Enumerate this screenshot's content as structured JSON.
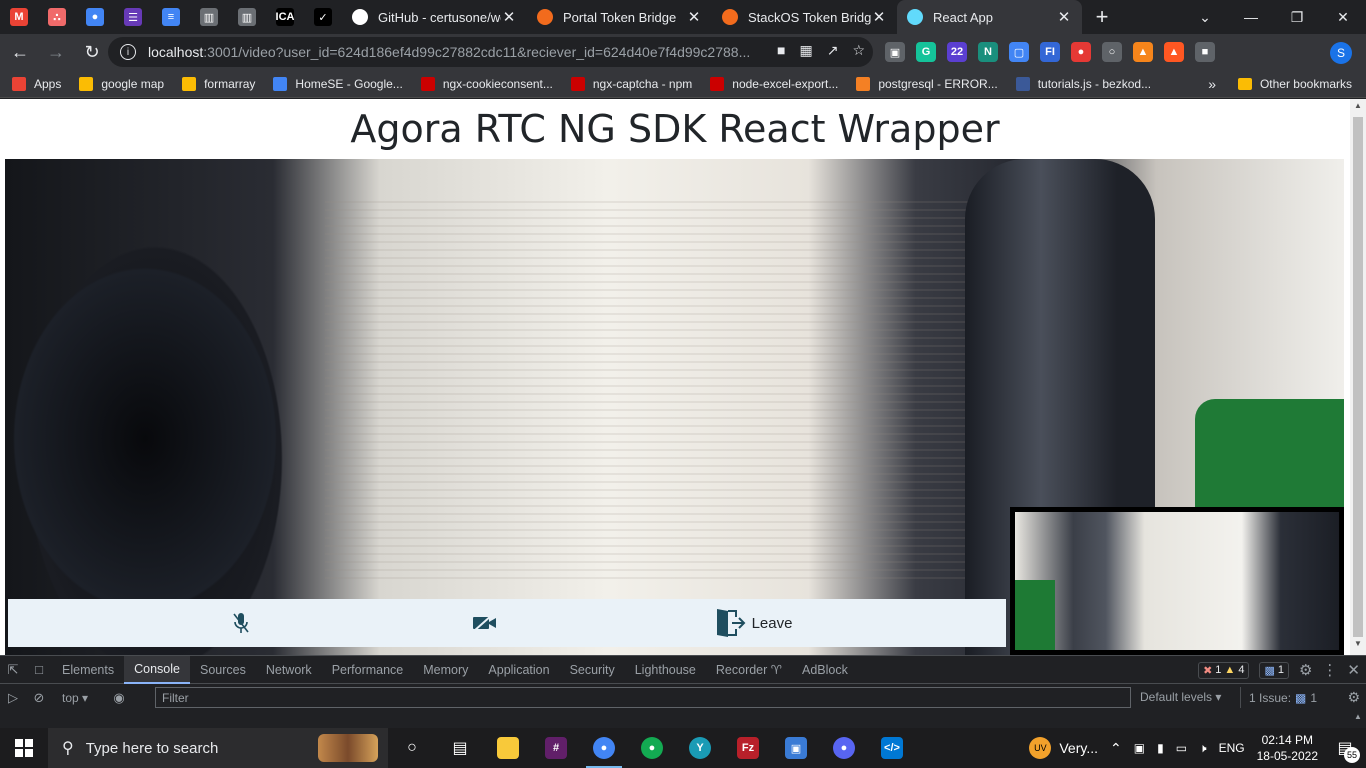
{
  "browser": {
    "pinned_tabs": [
      {
        "name": "gmail",
        "glyph": "M",
        "color": "#ea4335"
      },
      {
        "name": "asana",
        "glyph": "∴",
        "color": "#f06a6a"
      },
      {
        "name": "chrome-store",
        "glyph": "●",
        "color": "#4285f4"
      },
      {
        "name": "forms",
        "glyph": "☰",
        "color": "#673ab7"
      },
      {
        "name": "docs",
        "glyph": "≡",
        "color": "#4285f4"
      },
      {
        "name": "trello",
        "glyph": "▥",
        "color": "#6b6f74"
      },
      {
        "name": "trello-2",
        "glyph": "▥",
        "color": "#6b6f74"
      },
      {
        "name": "ica",
        "glyph": "ICA",
        "color": "#000000"
      },
      {
        "name": "circle",
        "glyph": "✓",
        "color": "#000000"
      }
    ],
    "tabs": [
      {
        "label": "GitHub - certusone/wo",
        "fav_color": "#ffffff",
        "active": false
      },
      {
        "label": "Portal Token Bridge",
        "fav_color": "#f26b1d",
        "active": false
      },
      {
        "label": "StackOS Token Bridge",
        "fav_color": "#f26b1d",
        "active": false
      },
      {
        "label": "React App",
        "fav_color": "#61dafb",
        "active": true
      }
    ],
    "new_tab": "+",
    "url_host": "localhost",
    "url_path": ":3001/video?user_id=624d186ef4d99c27882cdc11&reciever_id=624d40e7f4d99c2788...",
    "profile_initial": "S",
    "extensions": [
      {
        "name": "extension-a",
        "glyph": "▣",
        "color": "#5f6368"
      },
      {
        "name": "grammarly",
        "glyph": "G",
        "color": "#15c39a"
      },
      {
        "name": "extension-22",
        "glyph": "22",
        "color": "#5b3fd1"
      },
      {
        "name": "extension-n",
        "glyph": "N",
        "color": "#1a8f7d"
      },
      {
        "name": "extension-b",
        "glyph": "▢",
        "color": "#4285f4"
      },
      {
        "name": "extension-fi",
        "glyph": "FI",
        "color": "#3367d6"
      },
      {
        "name": "extension-red",
        "glyph": "●",
        "color": "#e53935"
      },
      {
        "name": "extension-c",
        "glyph": "○",
        "color": "#5f6368"
      },
      {
        "name": "metamask",
        "glyph": "▲",
        "color": "#f6851b"
      },
      {
        "name": "extension-fire",
        "glyph": "▲",
        "color": "#ff5722"
      },
      {
        "name": "camera",
        "glyph": "■",
        "color": "#5f6368"
      }
    ],
    "bookmarks": [
      {
        "label": "Apps",
        "color": "#ea4335"
      },
      {
        "label": "google map",
        "color": "#fbbc04"
      },
      {
        "label": "formarray",
        "color": "#fbbc04"
      },
      {
        "label": "HomeSE - Google...",
        "color": "#4285f4"
      },
      {
        "label": "ngx-cookieconsent...",
        "color": "#cb0000"
      },
      {
        "label": "ngx-captcha - npm",
        "color": "#cb0000"
      },
      {
        "label": "node-excel-export...",
        "color": "#cb0000"
      },
      {
        "label": "postgresql - ERROR...",
        "color": "#f48024"
      },
      {
        "label": "tutorials.js - bezkod...",
        "color": "#3b5998"
      }
    ],
    "bookmarks_more": "»",
    "other_bookmarks": "Other bookmarks"
  },
  "page": {
    "title": "Agora RTC NG SDK React Wrapper",
    "leave_label": "Leave"
  },
  "devtools": {
    "tabs": [
      {
        "label": "Elements",
        "active": false
      },
      {
        "label": "Console",
        "active": true
      },
      {
        "label": "Sources",
        "active": false
      },
      {
        "label": "Network",
        "active": false
      },
      {
        "label": "Performance",
        "active": false
      },
      {
        "label": "Memory",
        "active": false
      },
      {
        "label": "Application",
        "active": false
      },
      {
        "label": "Security",
        "active": false
      },
      {
        "label": "Lighthouse",
        "active": false
      },
      {
        "label": "Recorder ♈",
        "active": false
      },
      {
        "label": "AdBlock",
        "active": false
      }
    ],
    "errors": "1",
    "warnings": "4",
    "messages": "1",
    "context": "top",
    "filter_placeholder": "Filter",
    "levels": "Default levels ▾",
    "issues": "1 Issue:",
    "issues_count": "1"
  },
  "taskbar": {
    "search_placeholder": "Type here to search",
    "weather": "Very...",
    "lang": "ENG",
    "time": "02:14 PM",
    "date": "18-05-2022",
    "notifications": "55"
  }
}
